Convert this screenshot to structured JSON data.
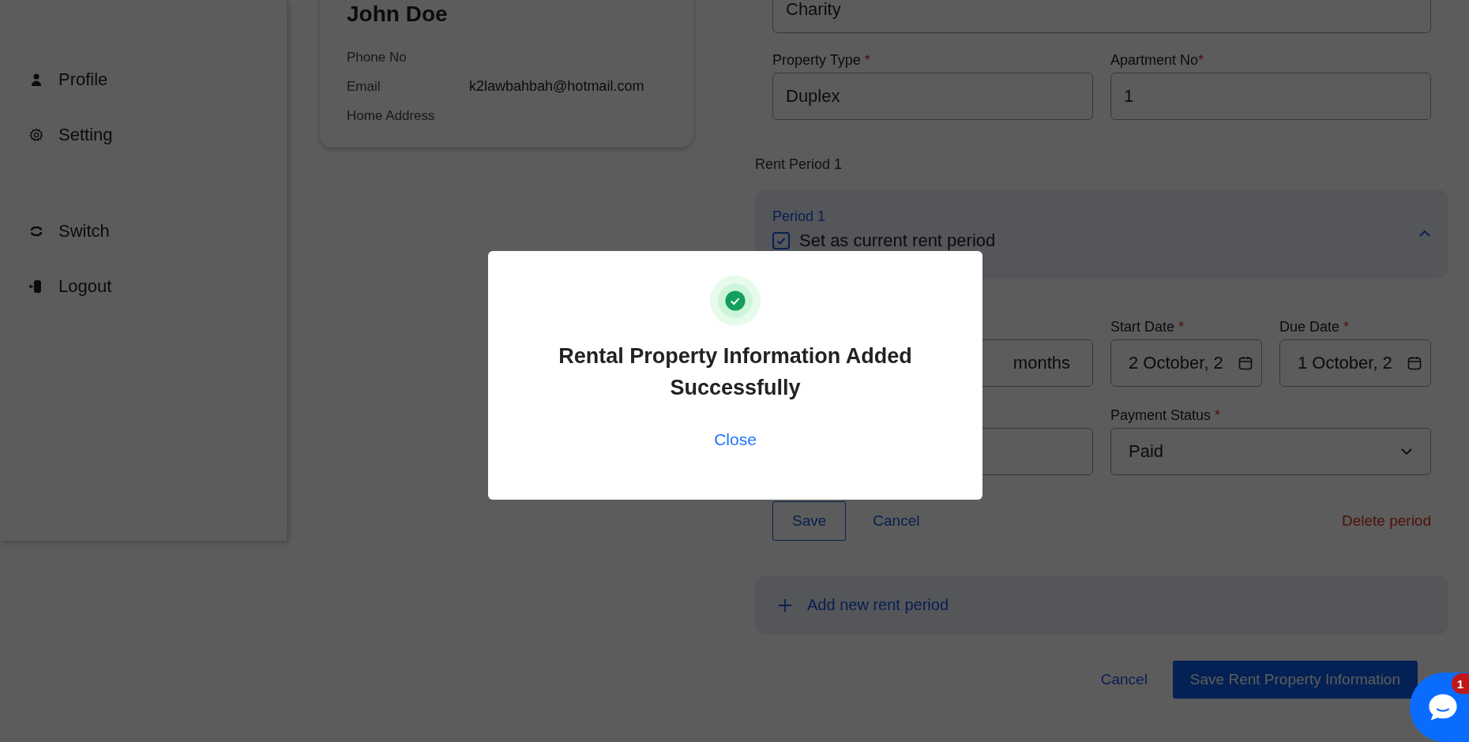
{
  "sidebar": {
    "items": [
      {
        "label": "Profile",
        "kind": "person"
      },
      {
        "label": "Setting",
        "kind": "gear"
      },
      {
        "label": "Switch",
        "kind": "switch"
      },
      {
        "label": "Logout",
        "kind": "logout"
      }
    ]
  },
  "profile_card": {
    "name": "John Doe",
    "rows": [
      {
        "label": "Phone No"
      },
      {
        "label": "Email",
        "value": "k2lawbahbah@hotmail.com"
      },
      {
        "label": "Home Address"
      }
    ]
  },
  "form": {
    "property_name": {
      "value": "Charity"
    },
    "property_type": {
      "label": "Property Type",
      "required_mark": "*",
      "value": "Duplex"
    },
    "apartment_no": {
      "label": "Apartment No",
      "required_mark": "*",
      "value": "1"
    },
    "rent_period_heading": "Rent Period 1",
    "period": {
      "title": "Period 1",
      "expanded": true,
      "current": {
        "label": "Set as current rent period",
        "checked": true
      },
      "duration": {
        "suffix": "months"
      },
      "start_date": {
        "label": "Start Date",
        "required_mark": "*",
        "value": "2 October, 2"
      },
      "due_date": {
        "label": "Due Date",
        "required_mark": "*",
        "value": "1 October, 2"
      },
      "payment_status": {
        "label": "Payment Status",
        "required_mark": "*",
        "value": "Paid"
      },
      "save": "Save",
      "cancel": "Cancel",
      "delete": "Delete period"
    },
    "add_period": "Add new rent period",
    "cancel": "Cancel",
    "submit": "Save Rent Property Information"
  },
  "dialog": {
    "title": "Rental Property Information Added Successfully",
    "close": "Close"
  },
  "chat": {
    "badge": "1"
  }
}
